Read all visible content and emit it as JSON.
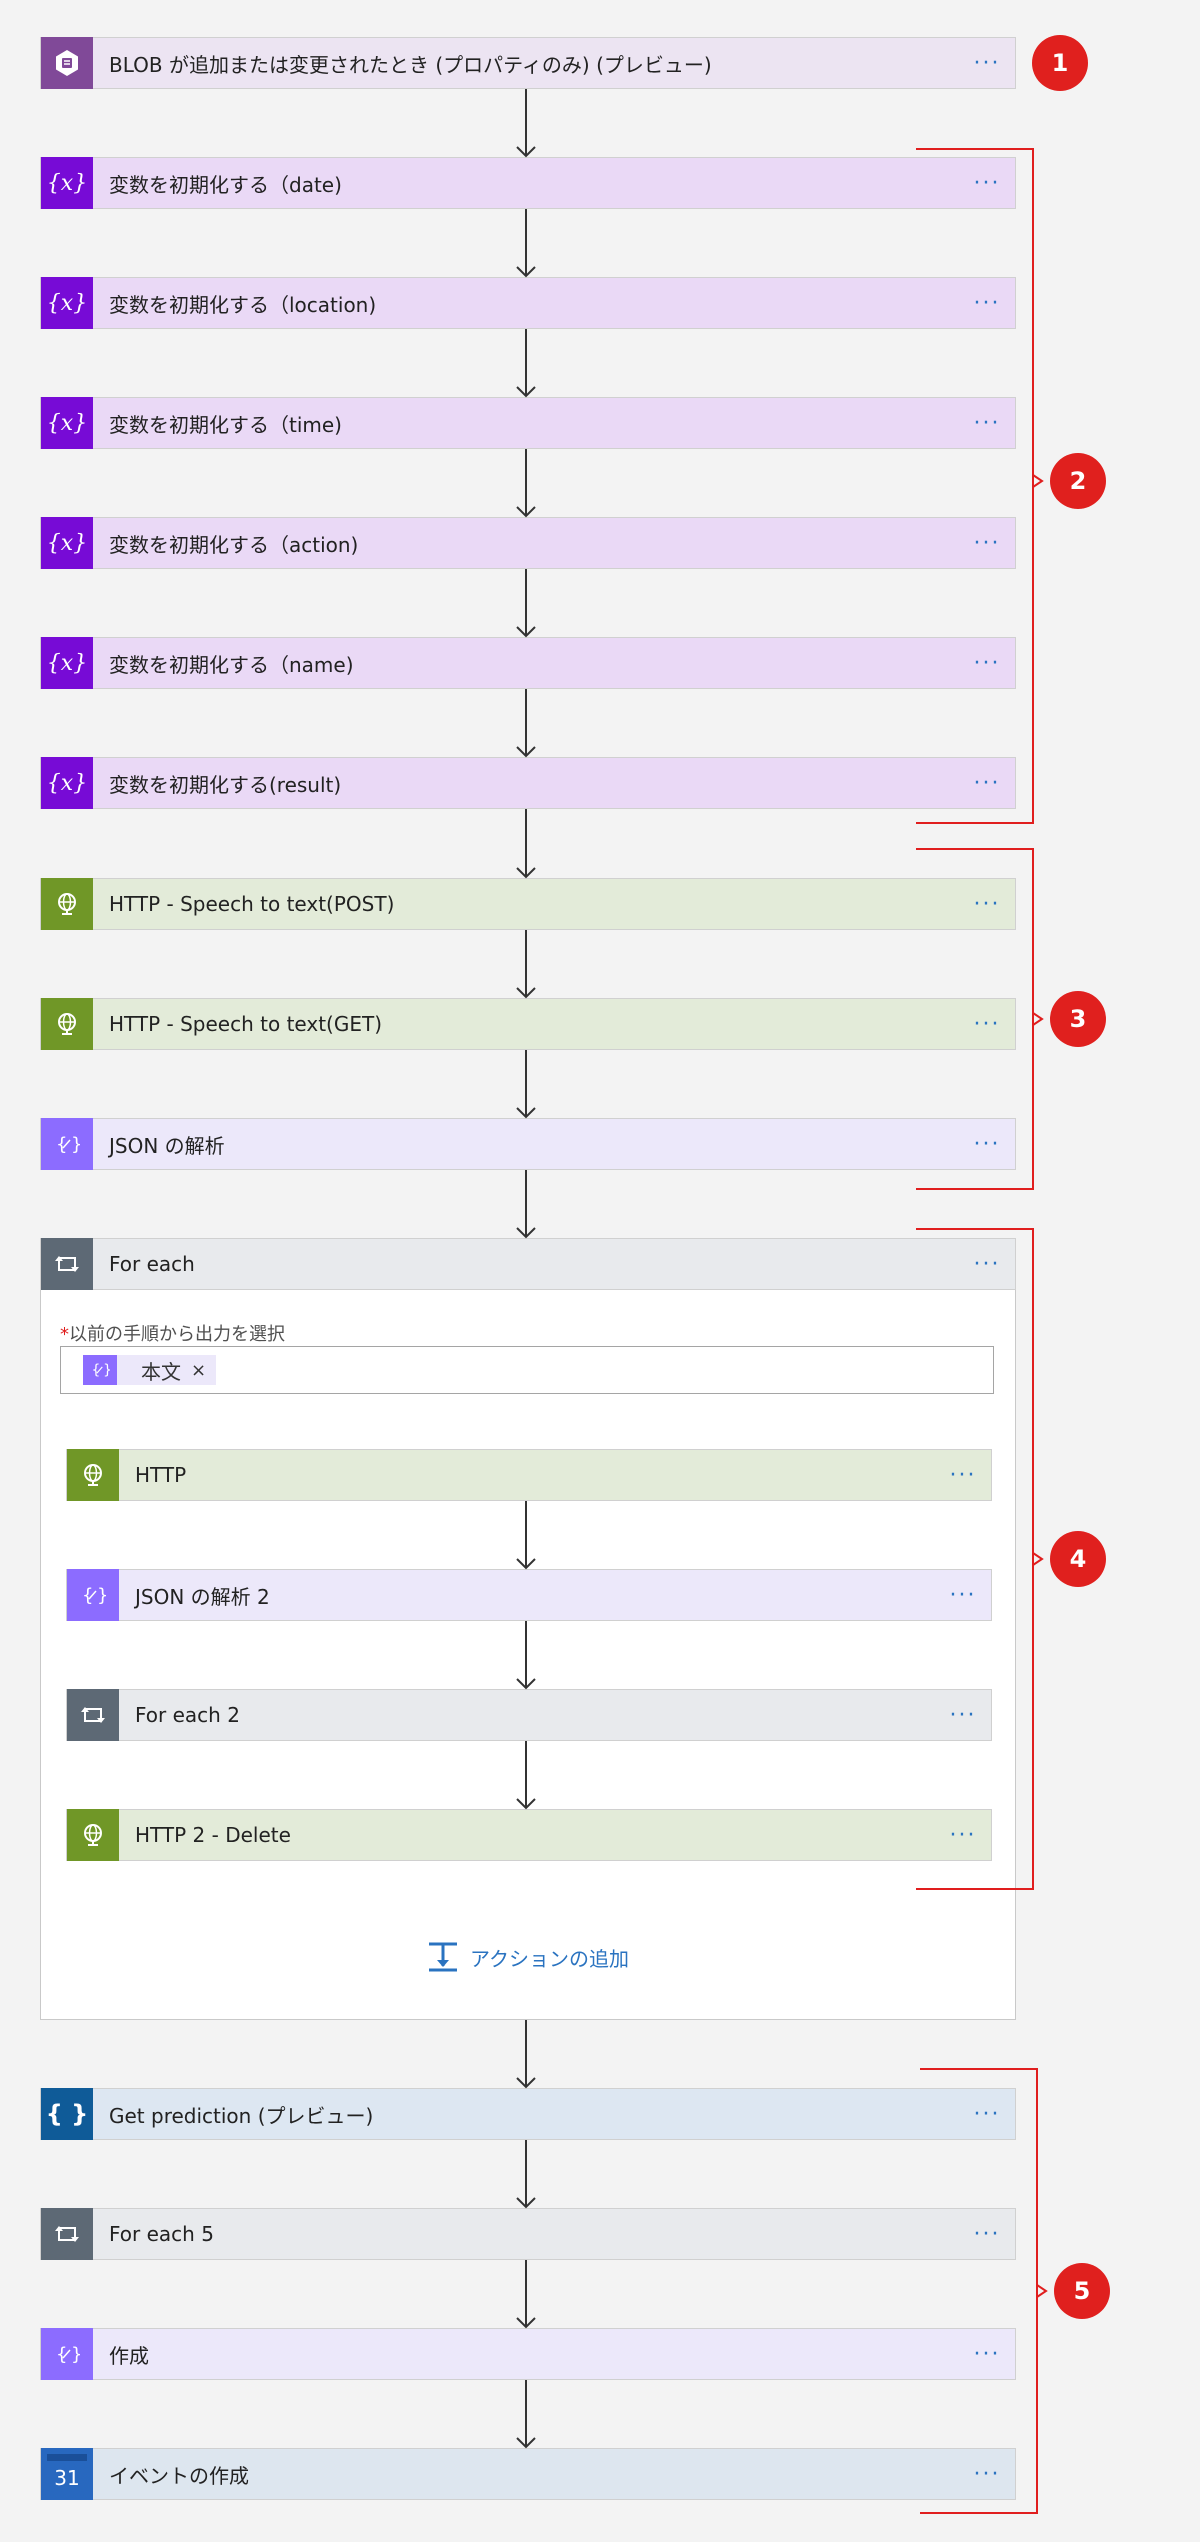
{
  "steps": {
    "trigger": {
      "label": "BLOB が追加または変更されたとき (プロパティのみ) (プレビュー)",
      "icon": "blob-storage-icon"
    },
    "var_date": {
      "label": "変数を初期化する（date)",
      "icon": "variable-icon"
    },
    "var_location": {
      "label": "変数を初期化する（location)",
      "icon": "variable-icon"
    },
    "var_time": {
      "label": "変数を初期化する（time)",
      "icon": "variable-icon"
    },
    "var_action": {
      "label": "変数を初期化する（action)",
      "icon": "variable-icon"
    },
    "var_name": {
      "label": "変数を初期化する（name)",
      "icon": "variable-icon"
    },
    "var_result": {
      "label": "変数を初期化する(result)",
      "icon": "variable-icon"
    },
    "http_post": {
      "label": "HTTP - Speech to text(POST)",
      "icon": "http-globe-icon"
    },
    "http_get": {
      "label": "HTTP - Speech to text(GET)",
      "icon": "http-globe-icon"
    },
    "json_parse": {
      "label": "JSON の解析",
      "icon": "data-operation-icon"
    },
    "for_each": {
      "label": "For each",
      "icon": "loop-icon"
    },
    "http": {
      "label": "HTTP",
      "icon": "http-globe-icon"
    },
    "json_parse_2": {
      "label": "JSON の解析 2",
      "icon": "data-operation-icon"
    },
    "for_each_2": {
      "label": "For each 2",
      "icon": "loop-icon"
    },
    "http_delete": {
      "label": "HTTP 2 - Delete",
      "icon": "http-globe-icon"
    },
    "get_prediction": {
      "label": "Get prediction (プレビュー)",
      "icon": "custom-connector-icon"
    },
    "for_each_5": {
      "label": "For each 5",
      "icon": "loop-icon"
    },
    "compose": {
      "label": "作成",
      "icon": "data-operation-icon"
    },
    "create_event": {
      "label": "イベントの作成",
      "icon": "calendar-icon"
    }
  },
  "ui": {
    "more_label": "···",
    "variable_glyph": "{x}",
    "predict_glyph": "{ }",
    "calendar_day": "31",
    "required_mark": "*",
    "for_each_field_label": "以前の手順から出力を選択",
    "for_each_chip_text": "本文",
    "for_each_chip_remove": "×",
    "add_action_label": "アクションの追加"
  },
  "annotations": [
    "1",
    "2",
    "3",
    "4",
    "5"
  ],
  "colors": {
    "accent_link": "#2a73c0",
    "annotation_red": "#e01e1e",
    "variable": "#770bd6",
    "http": "#709727",
    "data_operation": "#8c6cff",
    "loop": "#5d6975",
    "blob": "#804998",
    "prediction": "#0f5b98",
    "calendar": "#2868bf"
  }
}
